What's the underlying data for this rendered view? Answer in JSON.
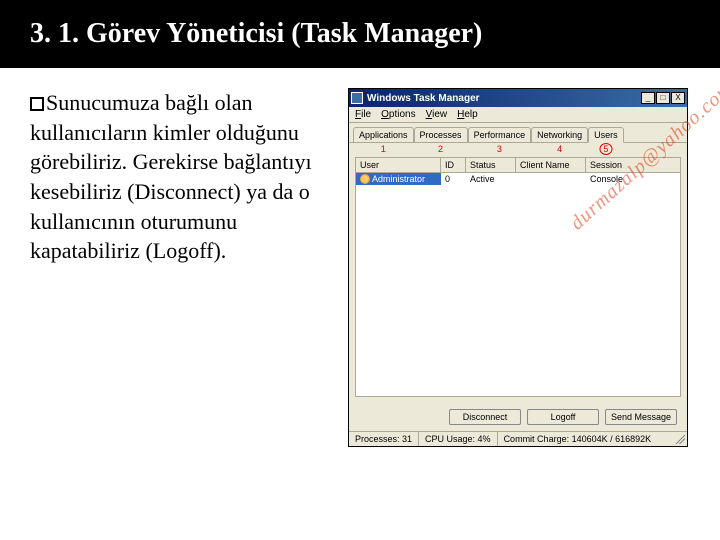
{
  "slide_title": "3. 1. Görev Yöneticisi (Task Manager)",
  "body_text": "Sunucumuza bağlı olan kullanıcıların kimler olduğunu görebiliriz. Gerekirse bağlantıyı kesebiliriz (Disconnect) ya da o kullanıcının oturumunu kapatabiliriz (Logoff).",
  "watermark": "durmazalp@yahoo.com",
  "window": {
    "title": "Windows Task Manager",
    "min": "_",
    "max": "□",
    "close": "X",
    "menu": {
      "file": "File",
      "options": "Options",
      "view": "View",
      "help": "Help"
    },
    "tabs": [
      {
        "label": "Applications",
        "num": "1"
      },
      {
        "label": "Processes",
        "num": "2"
      },
      {
        "label": "Performance",
        "num": "3"
      },
      {
        "label": "Networking",
        "num": "4"
      },
      {
        "label": "Users",
        "num": "5"
      }
    ],
    "columns": {
      "user": "User",
      "id": "ID",
      "status": "Status",
      "client": "Client Name",
      "session": "Session"
    },
    "rows": [
      {
        "user": "Administrator",
        "id": "0",
        "status": "Active",
        "client": "",
        "session": "Console"
      }
    ],
    "buttons": {
      "disconnect": "Disconnect",
      "logoff": "Logoff",
      "send": "Send Message"
    },
    "status": {
      "procs": "Processes: 31",
      "cpu": "CPU Usage: 4%",
      "commit": "Commit Charge: 140604K / 616892K"
    }
  }
}
